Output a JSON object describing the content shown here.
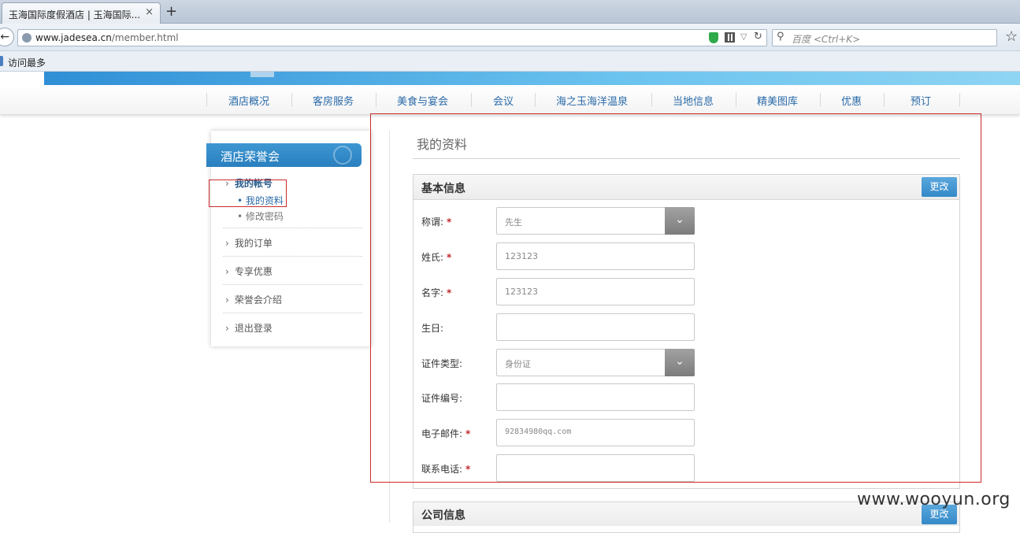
{
  "browser": {
    "tab_title": "玉海国际度假酒店 | 玉海国际...",
    "tab_close": "×",
    "new_tab": "+",
    "url_domain": "www.jadesea.cn",
    "url_path": "/member.html",
    "search_placeholder": "百度 <Ctrl+K>",
    "bookmark_label": "访问最多"
  },
  "main_nav": [
    "酒店概况",
    "客房服务",
    "美食与宴会",
    "会议",
    "海之玉海洋温泉",
    "当地信息",
    "精美图库",
    "优惠",
    "预订"
  ],
  "sidebar": {
    "title": "酒店荣誉会",
    "account_label": "我的帐号",
    "sub_items": [
      "我的资料",
      "修改密码"
    ],
    "items": [
      "我的订单",
      "专享优惠",
      "荣誉会介绍",
      "退出登录"
    ]
  },
  "content": {
    "page_title": "我的资料",
    "basic_panel_title": "基本信息",
    "edit_label": "更改",
    "company_panel_title": "公司信息",
    "fields": [
      {
        "label": "称谓:",
        "required": true,
        "value": "先生",
        "type": "select"
      },
      {
        "label": "姓氏:",
        "required": true,
        "value": "123123",
        "type": "text"
      },
      {
        "label": "名字:",
        "required": true,
        "value": "123123",
        "type": "text"
      },
      {
        "label": "生日:",
        "required": false,
        "value": "",
        "type": "text"
      },
      {
        "label": "证件类型:",
        "required": false,
        "value": "身份证",
        "type": "select"
      },
      {
        "label": "证件编号:",
        "required": false,
        "value": "",
        "type": "text"
      },
      {
        "label": "电子邮件:",
        "required": true,
        "value": "92834980qq.com",
        "type": "text"
      },
      {
        "label": "联系电话:",
        "required": true,
        "value": "",
        "type": "text"
      }
    ]
  },
  "watermark": "www.wooyun.org",
  "colors": {
    "accent": "#3489c8",
    "required": "#c0282b",
    "annotation": "#cc2b2b"
  }
}
